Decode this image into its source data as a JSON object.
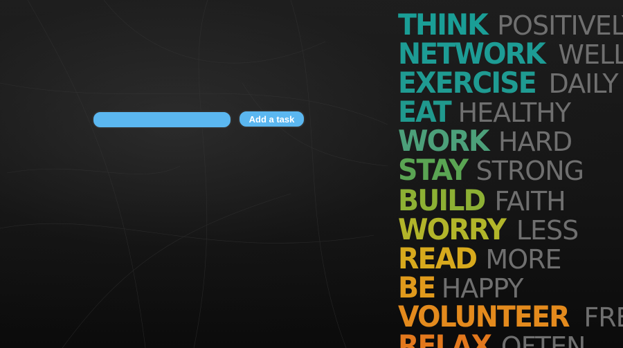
{
  "task_form": {
    "input_value": "",
    "input_placeholder": "",
    "add_button_label": "Add a task"
  },
  "colors": {
    "input_fill": "#5bb7f0",
    "button_fill": "#5bb7f0",
    "background": "#161616",
    "light_word": "#6f6f6f"
  },
  "poster": {
    "rows": [
      {
        "bold": "THINK",
        "light": "POSITIVELY",
        "color": "#1a9e96"
      },
      {
        "bold": "NETWORK",
        "light": "WELL",
        "color": "#1d9c95"
      },
      {
        "bold": "EXERCISE",
        "light": "DAILY",
        "color": "#1f9b92"
      },
      {
        "bold": "EAT",
        "light": "HEALTHY",
        "color": "#20998e"
      },
      {
        "bold": "WORK",
        "light": "HARD",
        "color": "#4ca07a"
      },
      {
        "bold": "STAY",
        "light": "STRONG",
        "color": "#5aa553"
      },
      {
        "bold": "BUILD",
        "light": "FAITH",
        "color": "#8db034"
      },
      {
        "bold": "WORRY",
        "light": "LESS",
        "color": "#b2b52a"
      },
      {
        "bold": "READ",
        "light": "MORE",
        "color": "#d7a91d"
      },
      {
        "bold": "BE",
        "light": "HAPPY",
        "color": "#e09a1c"
      },
      {
        "bold": "VOLUNTEER",
        "light": "FREQUENTLY",
        "color": "#e38a1d"
      },
      {
        "bold": "RELAX",
        "light": "OFTEN",
        "color": "#e2781d"
      }
    ]
  }
}
